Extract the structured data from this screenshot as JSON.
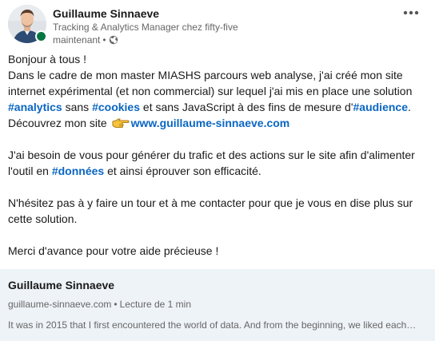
{
  "author": {
    "name": "Guillaume Sinnaeve",
    "headline": "Tracking & Analytics Manager chez fifty-five",
    "time": "maintenant",
    "separator": "•",
    "visibility_icon": "globe-icon",
    "online_status": "online"
  },
  "menu": {
    "icon": "more-horizontal-icon",
    "label": "•••"
  },
  "body": {
    "greeting": "Bonjour à tous !",
    "p1_text1": "Dans le cadre de mon master MIASHS parcours web analyse, j'ai créé mon site internet expérimental (et non commercial) sur lequel j'ai mis en place une solution ",
    "hashtag_analytics": "#analytics",
    "p1_text2": " sans ",
    "hashtag_cookies": "#cookies",
    "p1_text3": " et sans JavaScript à des fins de mesure d'",
    "hashtag_audience": "#audience",
    "p1_text4": ".",
    "discover_text": "Découvrez mon site ",
    "pointer_icon": "backhand-index-pointing-right-icon",
    "site_link": "www.guillaume-sinnaeve.com",
    "p2_text1": "J'ai besoin de vous pour générer du trafic et des actions sur le site afin d'alimenter l'outil en ",
    "hashtag_donnees": "#données",
    "p2_text2": " et ainsi éprouver son efficacité.",
    "p3": "N'hésitez pas à y faire un tour et à me contacter pour que je vous en dise plus sur cette solution.",
    "p4": "Merci d'avance pour votre aide précieuse !"
  },
  "preview": {
    "title": "Guillaume Sinnaeve",
    "domain": "guillaume-sinnaeve.com",
    "separator": "•",
    "read_time": "Lecture de 1 min",
    "excerpt": "It was in 2015 that I first encountered the world of data. And from the beginning, we liked each…"
  },
  "colors": {
    "link": "#0a66c2",
    "online": "#057642",
    "preview_bg": "#eef3f8",
    "muted": "#666666"
  }
}
